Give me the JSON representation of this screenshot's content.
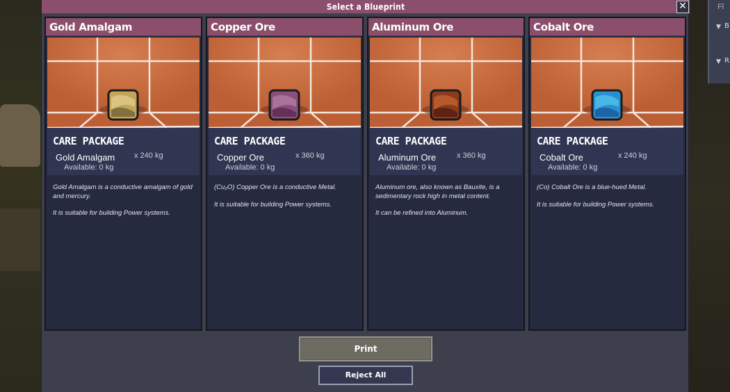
{
  "dialog": {
    "title": "Select a Blueprint",
    "close_icon": "close-icon"
  },
  "side_panel": {
    "label": "Fl",
    "item1": "B",
    "item2": "Ri"
  },
  "cards": [
    {
      "name": "Gold Amalgam",
      "package_label": "CARE PACKAGE",
      "item_name": "Gold Amalgam",
      "quantity": "x 240 kg",
      "available": "Available: 0 kg",
      "desc": [
        "Gold Amalgam is a conductive amalgam of gold and mercury.",
        "It is suitable for building Power systems."
      ],
      "ore_colors": [
        "#c2a55a",
        "#7a6a3a",
        "#e0c98a"
      ]
    },
    {
      "name": "Copper Ore",
      "package_label": "CARE PACKAGE",
      "item_name": "Copper Ore",
      "quantity": "x 360 kg",
      "available": "Available: 0 kg",
      "desc": [
        "(Cu₂O) Copper Ore is a conductive Metal.",
        "It is suitable for building Power systems."
      ],
      "ore_colors": [
        "#8a4f7a",
        "#5e2e55",
        "#b07aa0"
      ]
    },
    {
      "name": "Aluminum Ore",
      "package_label": "CARE PACKAGE",
      "item_name": "Aluminum Ore",
      "quantity": "x 360 kg",
      "available": "Available: 0 kg",
      "desc": [
        "Aluminum ore, also known as Bauxite, is a sedimentary rock high in metal content.",
        "It can be refined into Aluminum."
      ],
      "ore_colors": [
        "#8a3a1e",
        "#5a1f10",
        "#c0622e"
      ]
    },
    {
      "name": "Cobalt Ore",
      "package_label": "CARE PACKAGE",
      "item_name": "Cobalt Ore",
      "quantity": "x 240 kg",
      "available": "Available: 0 kg",
      "desc": [
        "(Co) Cobalt Ore is a blue-hued Metal.",
        "It is suitable for building Power systems."
      ],
      "ore_colors": [
        "#2a8fd0",
        "#1b5fa0",
        "#4fc0e8"
      ]
    }
  ],
  "buttons": {
    "print": "Print",
    "reject": "Reject All"
  }
}
